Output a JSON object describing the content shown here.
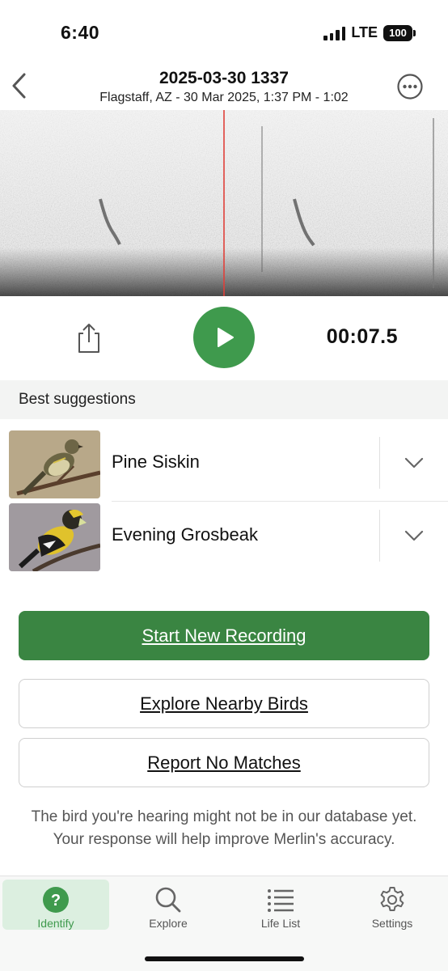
{
  "status_bar": {
    "time": "6:40",
    "network": "LTE",
    "battery": "100"
  },
  "header": {
    "title": "2025-03-30 1337",
    "subtitle": "Flagstaff, AZ - 30 Mar 2025, 1:37 PM - 1:02"
  },
  "playback": {
    "timer": "00:07.5"
  },
  "suggestions": {
    "heading": "Best suggestions",
    "items": [
      {
        "name": "Pine Siskin"
      },
      {
        "name": "Evening Grosbeak"
      }
    ]
  },
  "actions": {
    "start_recording": "Start New Recording",
    "explore_nearby": "Explore Nearby Birds",
    "report_no_matches": "Report No Matches"
  },
  "note": "The bird you're hearing might not be in our database yet. Your response will help improve Merlin's accuracy.",
  "tab_bar": {
    "identify": "Identify",
    "explore": "Explore",
    "life_list": "Life List",
    "settings": "Settings"
  },
  "colors": {
    "accent": "#3f9a4d",
    "primary_button": "#3a8542",
    "playhead": "#e0403a"
  }
}
